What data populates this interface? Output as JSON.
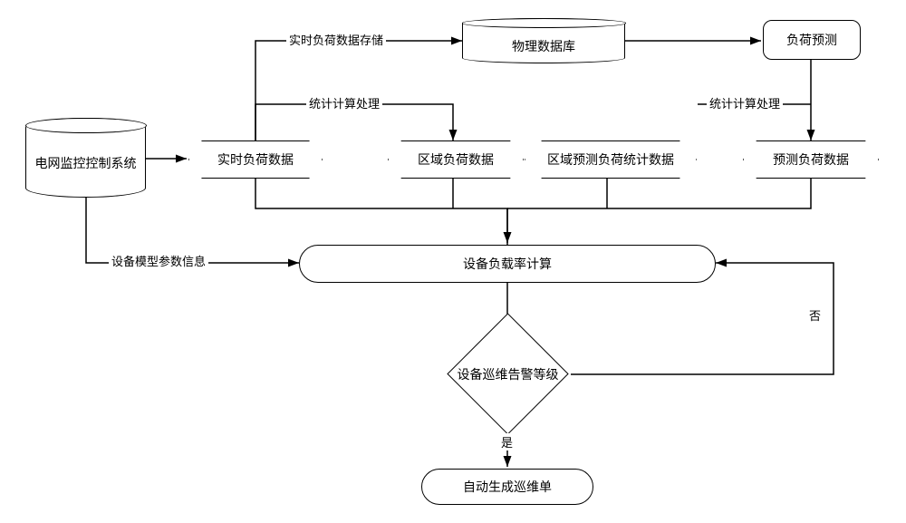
{
  "nodes": {
    "scada": "电网监控控制系统",
    "realtime": "实时负荷数据",
    "physdb": "物理数据库",
    "forecast": "负荷预测",
    "region": "区域负荷数据",
    "regionpred": "区域预测负荷统计数据",
    "preddata": "预测负荷数据",
    "loadcalc": "设备负载率计算",
    "alarmlvl": "设备巡维告警等级",
    "genticket": "自动生成巡维单"
  },
  "edges": {
    "store": "实时负荷数据存储",
    "stat1": "统计计算处理",
    "stat2": "统计计算处理",
    "model": "设备模型参数信息",
    "yes": "是",
    "no": "否"
  }
}
